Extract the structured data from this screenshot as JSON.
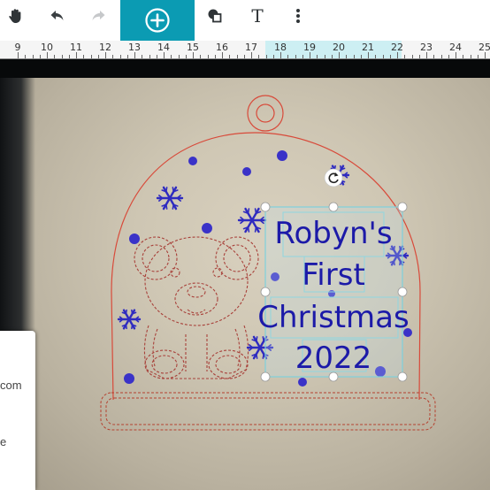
{
  "toolbar": {
    "pan_icon": "hand-icon",
    "undo_icon": "undo-icon",
    "redo_icon": "redo-icon",
    "add_icon": "plus-circle-icon",
    "shapes_icon": "shapes-icon",
    "text_icon": "T",
    "more_icon": "more-vertical-icon",
    "accent_color": "#0b9bb3"
  },
  "ruler": {
    "labels": [
      "9",
      "10",
      "11",
      "12",
      "13",
      "14",
      "15",
      "16",
      "17",
      "18",
      "19",
      "20",
      "21",
      "22",
      "23",
      "24",
      "25"
    ],
    "highlight_range": [
      "18",
      "22"
    ]
  },
  "design": {
    "text_lines": [
      "Robyn's",
      "First",
      "Christmas",
      "2022"
    ],
    "text_color": "#1c1aa8",
    "cut_line_color": "#d84a3a",
    "rotate_icon": "rotate-icon"
  },
  "side_panel": {
    "line1": "com",
    "line2": "e"
  }
}
